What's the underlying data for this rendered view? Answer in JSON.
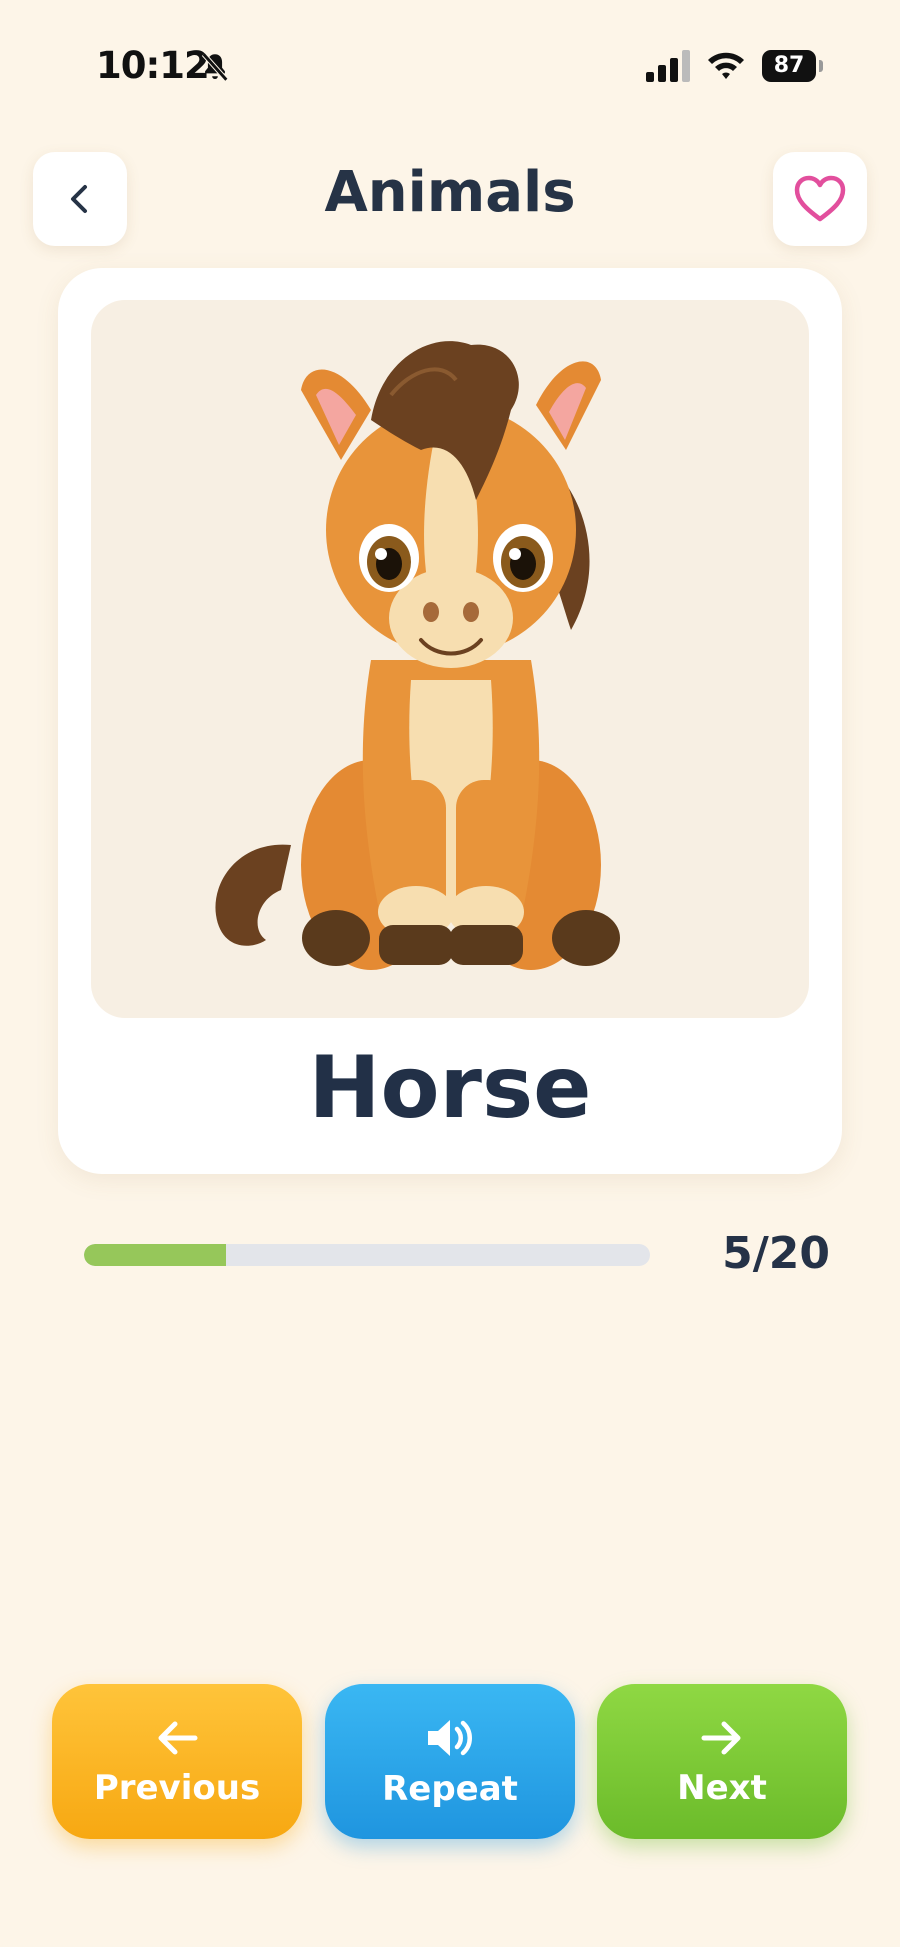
{
  "status": {
    "time": "10:12",
    "battery": "87"
  },
  "header": {
    "title": "Animals"
  },
  "card": {
    "word": "Horse"
  },
  "progress": {
    "current": 5,
    "total": 20,
    "label": "5/20",
    "fraction": 0.25
  },
  "buttons": {
    "previous": "Previous",
    "repeat": "Repeat",
    "next": "Next"
  },
  "colors": {
    "background": "#fdf5e8",
    "progress": "#96c75a",
    "previous": "#f7a812",
    "repeat": "#1f95df",
    "next": "#6bbb2a",
    "heart": "#e24f9d"
  },
  "icons": {
    "back": "chevron-left-icon",
    "favorite": "heart-icon",
    "previous": "arrow-left-icon",
    "repeat": "speaker-icon",
    "next": "arrow-right-icon"
  }
}
